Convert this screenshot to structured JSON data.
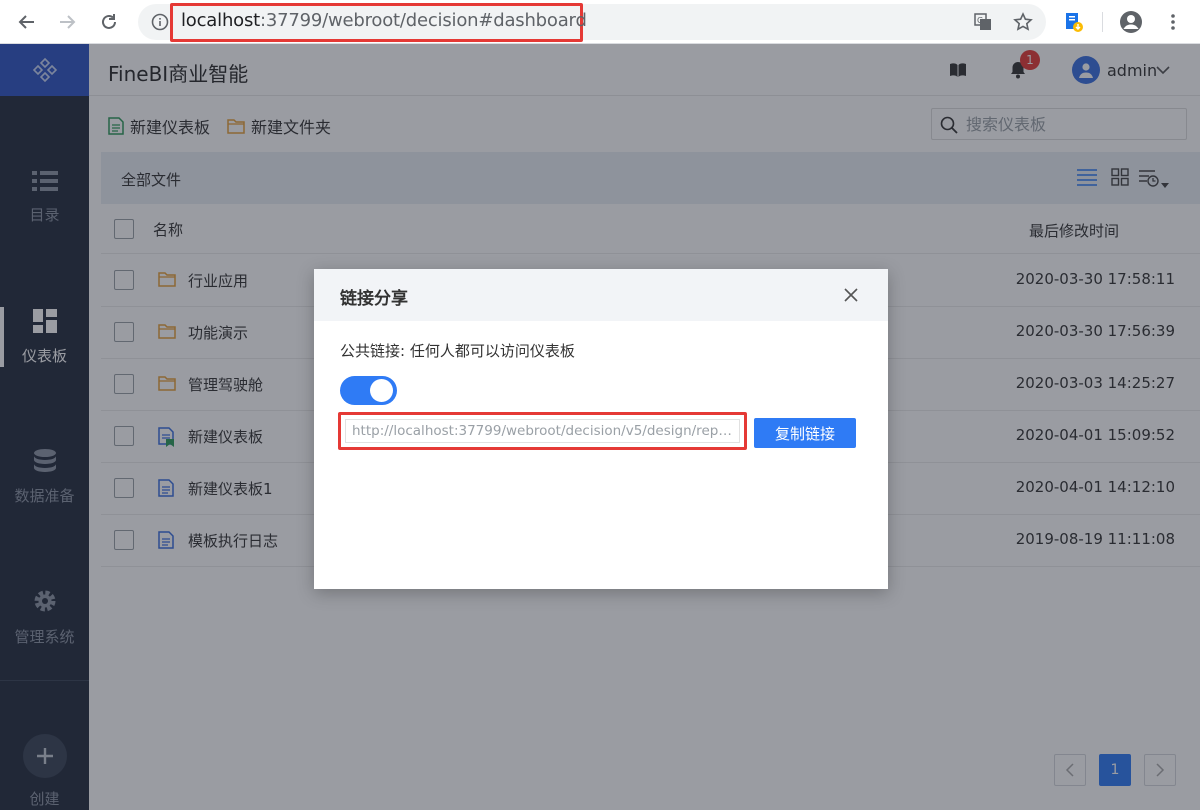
{
  "browser": {
    "url_host": "localhost",
    "url_rest": ":37799/webroot/decision#dashboard"
  },
  "app": {
    "title": "FineBI商业智能",
    "notification_count": "1",
    "user": "admin"
  },
  "sidebar": {
    "items": [
      {
        "label": "目录",
        "icon": "catalog-list-icon"
      },
      {
        "label": "仪表板",
        "icon": "dashboard-grid-icon"
      },
      {
        "label": "数据准备",
        "icon": "database-icon"
      },
      {
        "label": "管理系统",
        "icon": "gear-icon"
      }
    ],
    "create_label": "创建"
  },
  "toolbar": {
    "new_dashboard": "新建仪表板",
    "new_folder": "新建文件夹",
    "search_placeholder": "搜索仪表板"
  },
  "list": {
    "breadcrumb": "全部文件",
    "col_name": "名称",
    "col_time": "最后修改时间",
    "rows": [
      {
        "name": "行业应用",
        "time": "2020-03-30 17:58:11",
        "type": "folder"
      },
      {
        "name": "功能演示",
        "time": "2020-03-30 17:56:39",
        "type": "folder"
      },
      {
        "name": "管理驾驶舱",
        "time": "2020-03-03 14:25:27",
        "type": "folder"
      },
      {
        "name": "新建仪表板",
        "time": "2020-04-01 15:09:52",
        "type": "dashboard-shared"
      },
      {
        "name": "新建仪表板1",
        "time": "2020-04-01 14:12:10",
        "type": "dashboard"
      },
      {
        "name": "模板执行日志",
        "time": "2019-08-19 11:11:08",
        "type": "dashboard"
      }
    ]
  },
  "pagination": {
    "current": "1"
  },
  "dialog": {
    "title": "链接分享",
    "description": "公共链接: 任何人都可以访问仪表板",
    "public_link_enabled": true,
    "link_value": "http://localhost:37799/webroot/decision/v5/design/repo...",
    "copy_button": "复制链接"
  },
  "colors": {
    "accent": "#2f7bf5",
    "sidebar": "#232c3d",
    "highlight": "#e53935"
  }
}
